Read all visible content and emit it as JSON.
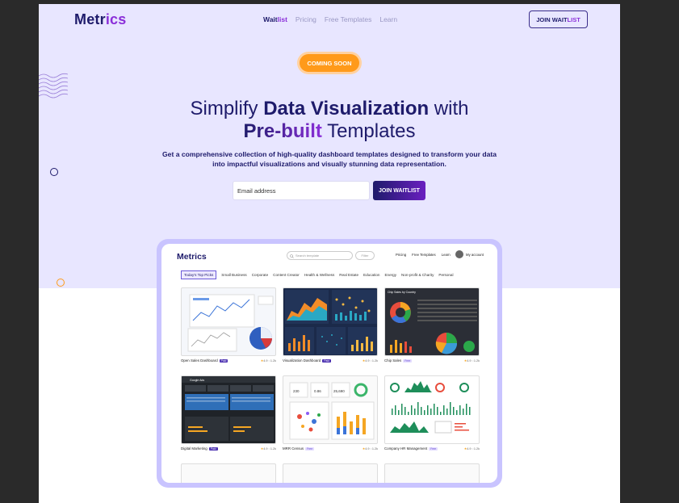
{
  "nav": {
    "logo_main": "Metr",
    "logo_accent": "ics",
    "links": {
      "waitlist_main": "Wait",
      "waitlist_accent": "list",
      "pricing": "Pricing",
      "free_templates": "Free Templates",
      "learn": "Learn"
    },
    "join_main": "JOIN WAIT",
    "join_accent": "LIST"
  },
  "hero": {
    "badge": "COMING SOON",
    "title_1": "Simplify ",
    "title_2": "Data Visualization",
    "title_3": " with",
    "title_4": "Pre-built",
    "title_5": " Templates",
    "subtitle": "Get a comprehensive collection of high-quality dashboard templates designed to transform your data into impactful visualizations and visually stunning data representation.",
    "email_placeholder": "Email address",
    "join_button": "JOIN WAITLIST"
  },
  "preview": {
    "logo": "Metrics",
    "search_placeholder": "Search template",
    "filter": "Filter",
    "links": [
      "Pricing",
      "Free Templates",
      "Learn"
    ],
    "account": "My account",
    "categories": [
      "Today's Top Picks",
      "Small Business",
      "Corporate",
      "Content Creator",
      "Health & Wellness",
      "Real Estate",
      "Education",
      "Energy",
      "Non-profit & Charity",
      "Personal"
    ],
    "cards": [
      {
        "name": "Open Sales Dashboard",
        "tag": "Paid",
        "rating": "4.9",
        "views": "1.2k"
      },
      {
        "name": "Visualization Dashboard",
        "tag": "Paid",
        "rating": "4.9",
        "views": "1.2k"
      },
      {
        "name": "Chip Sales",
        "tag": "Free",
        "rating": "4.9",
        "views": "1.2k"
      },
      {
        "name": "Digital Marketing",
        "tag": "Paid",
        "rating": "4.9",
        "views": "1.2k"
      },
      {
        "name": "MRR Census",
        "tag": "Free",
        "rating": "4.9",
        "views": "1.2k"
      },
      {
        "name": "Company HR Management",
        "tag": "Free",
        "rating": "4.9",
        "views": "1.2k"
      }
    ],
    "thumb_texts": {
      "chip_sales_header": "Chip Sales by Country",
      "mrr_1": "230",
      "mrr_2": "0.86",
      "mrr_3": "25,690",
      "google_ads": "Google Ads"
    }
  },
  "colors": {
    "brand": "#1e1b6b",
    "accent": "#8b2fd9",
    "hero_bg": "#e8e6ff",
    "badge": "#ff9a1a",
    "frame": "#c9c4ff"
  }
}
